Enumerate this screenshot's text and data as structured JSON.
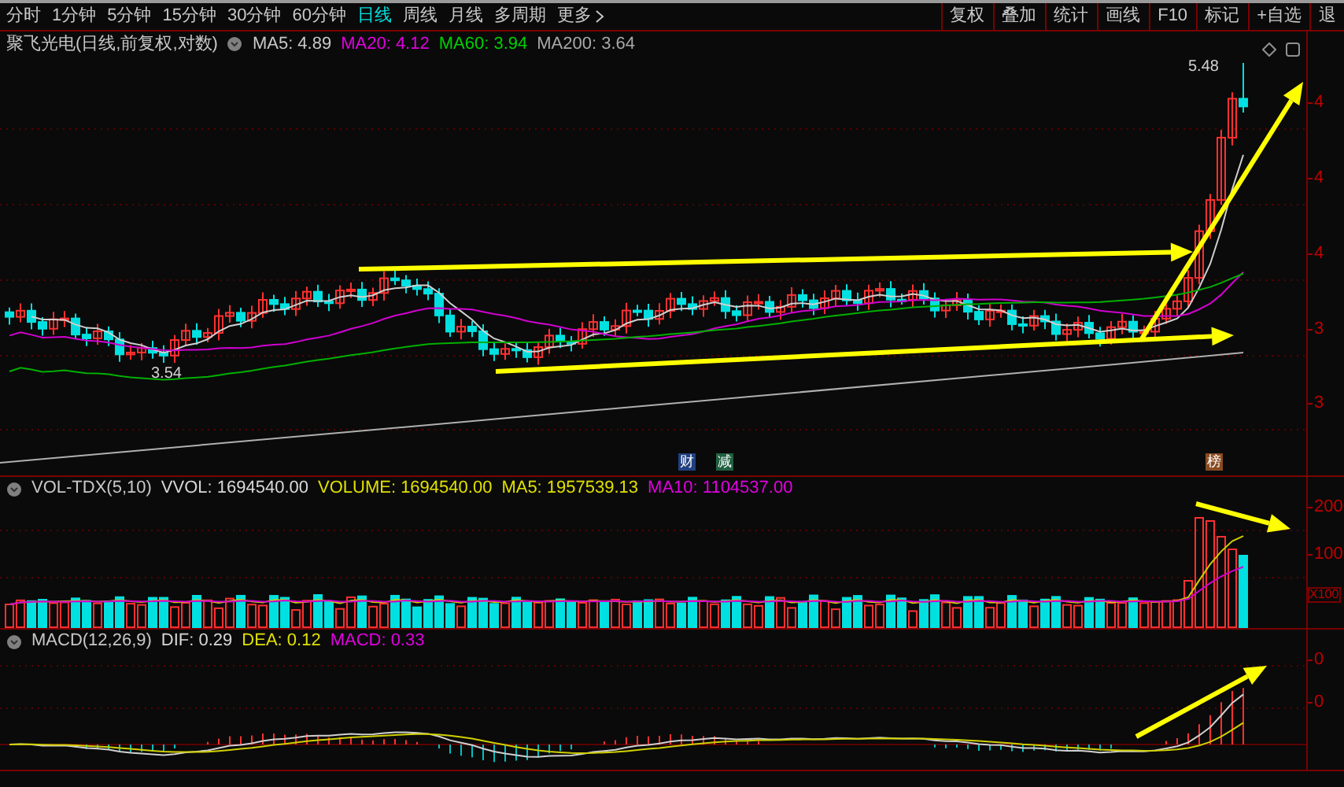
{
  "toolbar": {
    "periods": [
      {
        "label": "分时",
        "selected": false
      },
      {
        "label": "1分钟",
        "selected": false
      },
      {
        "label": "5分钟",
        "selected": false
      },
      {
        "label": "15分钟",
        "selected": false
      },
      {
        "label": "30分钟",
        "selected": false
      },
      {
        "label": "60分钟",
        "selected": false
      },
      {
        "label": "日线",
        "selected": true
      },
      {
        "label": "周线",
        "selected": false
      },
      {
        "label": "月线",
        "selected": false
      },
      {
        "label": "多周期",
        "selected": false
      }
    ],
    "more": "更多",
    "tools": [
      "复权",
      "叠加",
      "统计",
      "画线",
      "F10",
      "标记",
      "+自选",
      "退"
    ]
  },
  "price_panel": {
    "title": "聚飞光电(日线,前复权,对数)",
    "indicators": [
      {
        "label": "MA5: 4.89",
        "color": "#c8c8c8"
      },
      {
        "label": "MA20: 4.12",
        "color": "#e000e0"
      },
      {
        "label": "MA60: 3.94",
        "color": "#00d000"
      },
      {
        "label": "MA200: 3.64",
        "color": "#a8a8a8"
      }
    ],
    "low_label": "3.54",
    "high_label": "5.48",
    "markers": [
      "财",
      "减",
      "榜"
    ],
    "axis_labels": [
      "4",
      "4",
      "4",
      "3",
      "3"
    ]
  },
  "volume_panel": {
    "title": "VOL-TDX(5,10)",
    "indicators": [
      {
        "label": "VVOL: 1694540.00",
        "color": "#d8d8d8"
      },
      {
        "label": "VOLUME: 1694540.00",
        "color": "#e0e000"
      },
      {
        "label": "MA5: 1957539.13",
        "color": "#e0e000"
      },
      {
        "label": "MA10: 1104537.00",
        "color": "#e000e0"
      }
    ],
    "axis_labels": [
      "200",
      "100"
    ],
    "unit": "X100"
  },
  "macd_panel": {
    "title": "MACD(12,26,9)",
    "indicators": [
      {
        "label": "DIF: 0.29",
        "color": "#d8d8d8"
      },
      {
        "label": "DEA: 0.12",
        "color": "#e0e000"
      },
      {
        "label": "MACD: 0.33",
        "color": "#e000e0"
      }
    ],
    "axis_labels": [
      "0",
      "0"
    ]
  }
}
